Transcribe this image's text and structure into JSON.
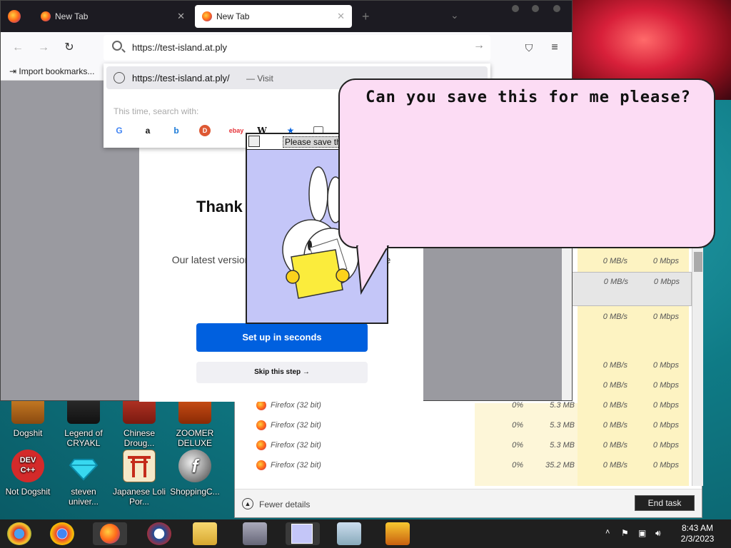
{
  "browser": {
    "tabs": [
      {
        "label": "New Tab",
        "active": false
      },
      {
        "label": "New Tab",
        "active": true
      }
    ],
    "url": "https://test-island.at.ply",
    "bookmarks_import": "Import bookmarks...",
    "dropdown": {
      "suggestion_url": "https://test-island.at.ply/",
      "suggestion_action": "— Visit",
      "search_with": "This time, search with:",
      "engines": [
        "google-icon",
        "amazon-icon",
        "bing-icon",
        "duckduckgo-icon",
        "ebay-icon",
        "wikipedia-icon",
        "bookmark-icon",
        "tabs-icon"
      ]
    },
    "onboarding": {
      "heading": "Thank",
      "body": "Our latest version is         ner than ever to zip a feature",
      "primary_button": "Set up in seconds",
      "secondary_button": "Skip this step →"
    }
  },
  "popup": {
    "title": "Please save th"
  },
  "bubble": {
    "text": "Can you save this for me please?"
  },
  "taskmgr": {
    "process_name": "Firefox (32 bit)",
    "rows": [
      {
        "cpu": "",
        "mem": "",
        "disk": "0 MB/s",
        "net": "0 Mbps",
        "named": false
      },
      {
        "cpu": "",
        "mem": "",
        "disk": "0 MB/s",
        "net": "0 Mbps",
        "named": false
      },
      {
        "cpu": "",
        "mem": "",
        "disk": "0 MB/s",
        "net": "0 Mbps",
        "named": false
      },
      {
        "cpu": "",
        "mem": "",
        "disk": "0 MB/s",
        "net": "0 Mbps",
        "named": false
      },
      {
        "cpu": "",
        "mem": "",
        "disk": "0 MB/s",
        "net": "0 Mbps",
        "named": false
      },
      {
        "cpu": "0%",
        "mem": "5.3 MB",
        "disk": "0 MB/s",
        "net": "0 Mbps",
        "named": true
      },
      {
        "cpu": "0%",
        "mem": "5.3 MB",
        "disk": "0 MB/s",
        "net": "0 Mbps",
        "named": true
      },
      {
        "cpu": "0%",
        "mem": "5.3 MB",
        "disk": "0 MB/s",
        "net": "0 Mbps",
        "named": true
      },
      {
        "cpu": "0%",
        "mem": "35.2 MB",
        "disk": "0 MB/s",
        "net": "0 Mbps",
        "named": true
      }
    ],
    "fewer_details": "Fewer details",
    "end_task": "End task"
  },
  "desktop_icons": [
    {
      "label": "Dogshit",
      "icon": "dogshit-icon"
    },
    {
      "label": "Legend of CRYAKL",
      "icon": "game-icon"
    },
    {
      "label": "Chinese Droug...",
      "icon": "folder-icon"
    },
    {
      "label": "ZOOMER DELUXE",
      "icon": "zoomer-icon"
    },
    {
      "label": "Not Dogshit",
      "icon": "devcpp-icon"
    },
    {
      "label": "steven univer...",
      "icon": "diamond-icon"
    },
    {
      "label": "Japanese Loli Por...",
      "icon": "torii-icon"
    },
    {
      "label": "ShoppingC...",
      "icon": "flash-icon"
    }
  ],
  "taskbar": {
    "time": "8:43 AM",
    "date": "2/3/2023"
  },
  "colors": {
    "firefox_blue": "#0060df",
    "bubble_pink": "#fcdcf4",
    "popup_lavender": "#c4c6f8",
    "taskmgr_yellow": "#fdf3c2"
  }
}
